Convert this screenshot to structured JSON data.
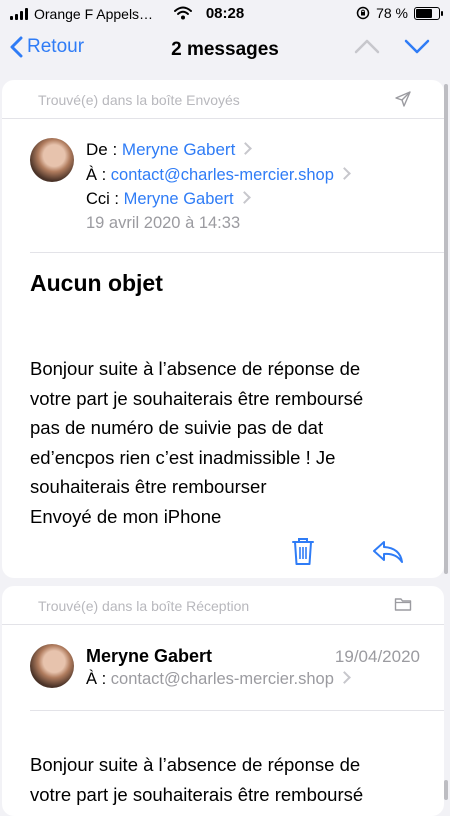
{
  "status_bar": {
    "carrier": "Orange F Appels…",
    "time": "08:28",
    "battery": "78 %",
    "battery_level": 0.78
  },
  "nav": {
    "back_label": "Retour",
    "title": "2 messages"
  },
  "message1": {
    "folder_note": "Trouvé(e) dans la boîte Envoyés",
    "from_label": "De :",
    "from_name": "Meryne Gabert",
    "to_label": "À :",
    "to_address": "contact@charles-mercier.shop",
    "cci_label": "Cci :",
    "cci_name": "Meryne Gabert",
    "date": "19 avril 2020 à 14:33",
    "subject": "Aucun objet",
    "body_lines": [
      "Bonjour suite à l’absence de réponse de",
      "votre part je souhaiterais être remboursé",
      "pas de numéro de suivie pas de dat",
      "ed’encpos rien c’est inadmissible ! Je",
      "souhaiterais être rembourser",
      "Envoyé de mon iPhone"
    ]
  },
  "message2": {
    "folder_note": "Trouvé(e) dans la boîte Réception",
    "from_name": "Meryne Gabert",
    "date": "19/04/2020",
    "to_label": "À :",
    "to_address": "contact@charles-mercier.shop",
    "body_lines": [
      "Bonjour suite à l’absence de réponse de",
      "votre part je souhaiterais être remboursé"
    ]
  },
  "colors": {
    "accent": "#2f7cf6",
    "background": "#f2f2f6",
    "secondary_text": "#9b9ba0"
  }
}
